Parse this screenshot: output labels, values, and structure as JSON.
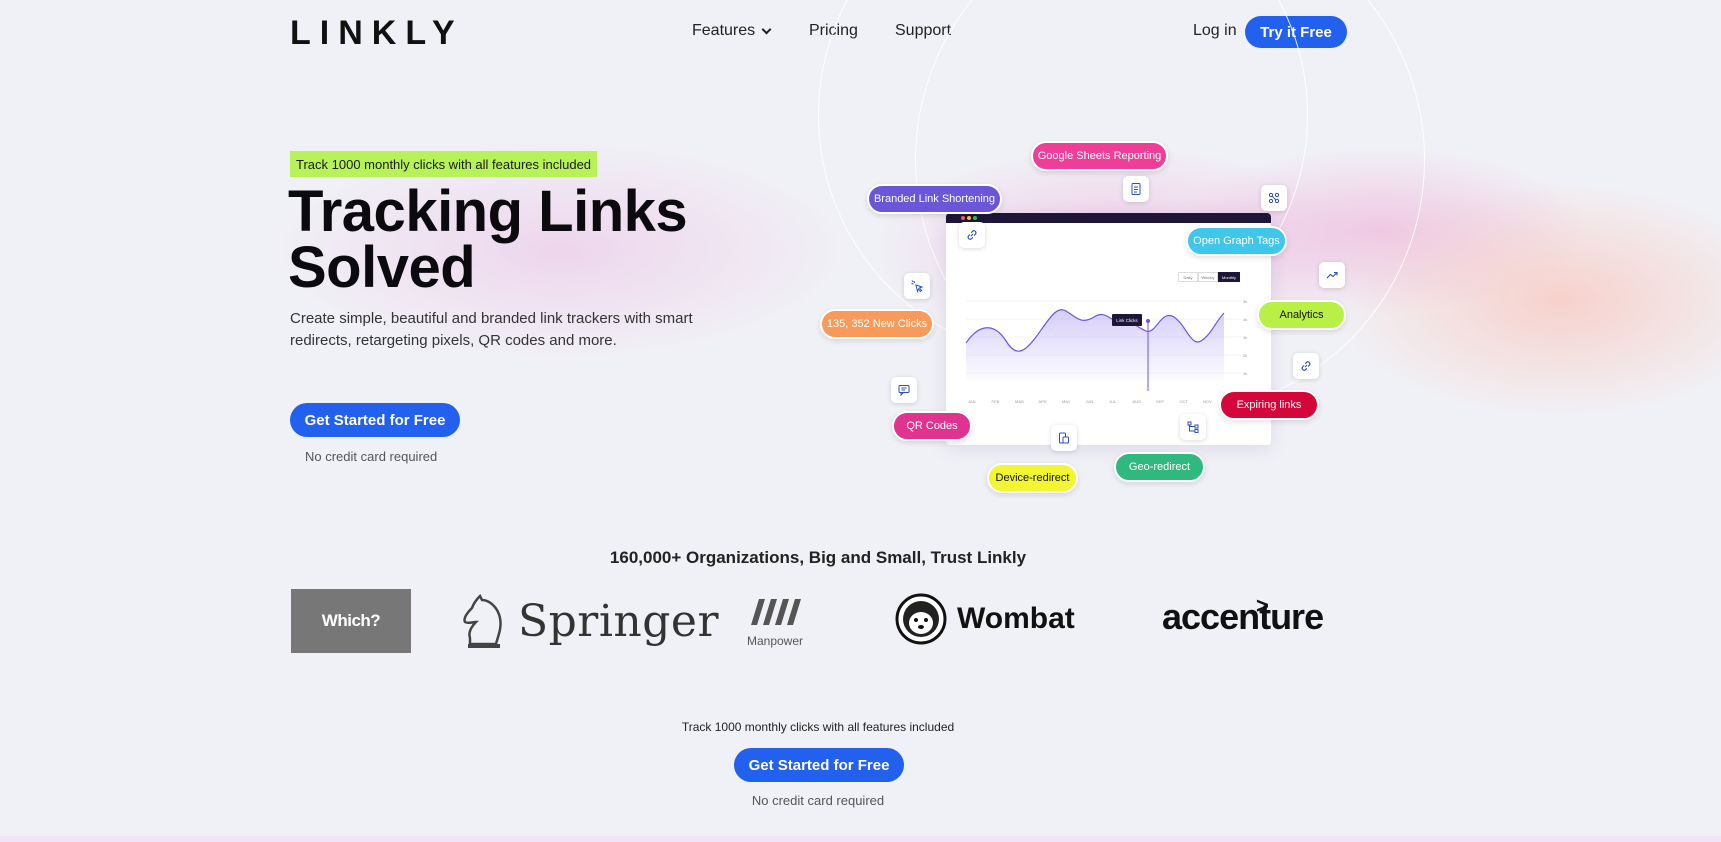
{
  "header": {
    "logo": "LINKLY",
    "nav": {
      "features": "Features",
      "pricing": "Pricing",
      "support": "Support"
    },
    "login": "Log in",
    "try_free": "Try it Free"
  },
  "hero": {
    "promo_tag": "Track 1000 monthly clicks with all features included",
    "title_line1": "Tracking Links",
    "title_line2": "Solved",
    "subtitle": "Create simple, beautiful and branded link trackers with smart redirects, retargeting pixels, QR codes and more.",
    "cta": "Get Started for Free",
    "note": "No credit card required"
  },
  "illustration": {
    "pills": {
      "google_sheets": "Google Sheets Reporting",
      "branded_link": "Branded Link Shortening",
      "open_graph": "Open Graph Tags",
      "new_clicks": "135, 352 New Clicks",
      "analytics": "Analytics",
      "expiring": "Expiring links",
      "qr_codes": "QR Codes",
      "device_redirect": "Device-redirect",
      "geo_redirect": "Geo-redirect"
    },
    "colors": {
      "google_sheets": "#ee3e97",
      "branded_link": "#6b56d8",
      "open_graph": "#3fc6ea",
      "new_clicks": "#f79a5a",
      "analytics": "#b9f046",
      "expiring": "#d4063a",
      "qr_codes": "#e0338f",
      "device_redirect": "#f2f531",
      "geo_redirect": "#2fb97e"
    },
    "segments": [
      "Daily",
      "Weekly",
      "Monthly"
    ],
    "tooltip": "Link Clicks",
    "months": [
      "JAN",
      "FEB",
      "MAR",
      "APR",
      "MAY",
      "JUN",
      "JUL",
      "AUG",
      "SEP",
      "OCT",
      "NOV"
    ],
    "y_ticks": [
      "5k",
      "4k",
      "3k",
      "2k",
      "1k"
    ]
  },
  "trust": {
    "title": "160,000+ Organizations, Big and Small, Trust Linkly",
    "logos": {
      "which": "Which?",
      "springer": "Springer",
      "manpower": "Manpower",
      "wombat": "Wombat",
      "accenture": "accenture"
    }
  },
  "bottom_cta": {
    "text": "Track 1000 monthly clicks with all features included",
    "button": "Get Started for Free",
    "note": "No credit card required"
  },
  "theme": {
    "accent": "#2260ee",
    "promo_green": "#b7f258",
    "dark": "#1d1638"
  }
}
